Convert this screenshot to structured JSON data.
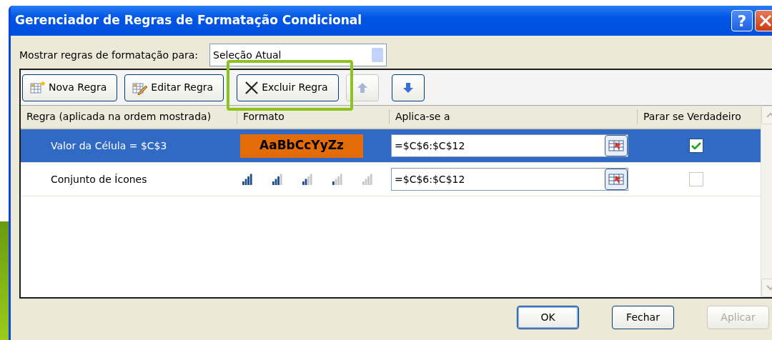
{
  "window": {
    "title": "Gerenciador de Regras de Formatação Condicional",
    "help": "?"
  },
  "show_rules_for": {
    "label": "Mostrar regras de formatação para:",
    "value": "Seleção Atual"
  },
  "toolbar": [
    {
      "kind": "new",
      "label": "Nova Regra",
      "highlighted": false
    },
    {
      "kind": "edit",
      "label": "Editar Regra",
      "highlighted": false
    },
    {
      "kind": "delete",
      "label": "Excluir Regra",
      "highlighted": true
    }
  ],
  "move_up": {
    "disabled": true
  },
  "move_down": {
    "disabled": false
  },
  "columns": [
    "Regra (aplicada na ordem mostrada)",
    "Formato",
    "Aplica-se a",
    "Parar se Verdadeiro"
  ],
  "rules": [
    {
      "rule": "Valor da Célula = $C$3",
      "kind": "preview",
      "preview": "AaBbCcYyZz",
      "color": "#e36c09",
      "applies_to": "=$C$6:$C$12",
      "stop_if_true": true,
      "selected": true
    },
    {
      "rule": "Conjunto de Ícones",
      "kind": "icon_set",
      "applies_to": "=$C$6:$C$12",
      "stop_if_true": false,
      "selected": false
    }
  ],
  "footer": [
    {
      "label": "OK",
      "disabled": false,
      "default": true
    },
    {
      "label": "Fechar",
      "disabled": false,
      "default": false
    },
    {
      "label": "Aplicar",
      "disabled": true,
      "default": false
    }
  ]
}
